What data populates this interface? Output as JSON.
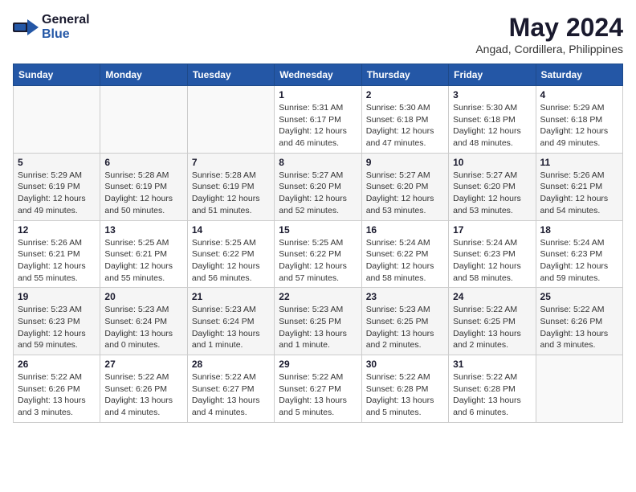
{
  "logo": {
    "general": "General",
    "blue": "Blue"
  },
  "title": "May 2024",
  "subtitle": "Angad, Cordillera, Philippines",
  "days_of_week": [
    "Sunday",
    "Monday",
    "Tuesday",
    "Wednesday",
    "Thursday",
    "Friday",
    "Saturday"
  ],
  "weeks": [
    [
      {
        "day": "",
        "info": ""
      },
      {
        "day": "",
        "info": ""
      },
      {
        "day": "",
        "info": ""
      },
      {
        "day": "1",
        "info": "Sunrise: 5:31 AM\nSunset: 6:17 PM\nDaylight: 12 hours\nand 46 minutes."
      },
      {
        "day": "2",
        "info": "Sunrise: 5:30 AM\nSunset: 6:18 PM\nDaylight: 12 hours\nand 47 minutes."
      },
      {
        "day": "3",
        "info": "Sunrise: 5:30 AM\nSunset: 6:18 PM\nDaylight: 12 hours\nand 48 minutes."
      },
      {
        "day": "4",
        "info": "Sunrise: 5:29 AM\nSunset: 6:18 PM\nDaylight: 12 hours\nand 49 minutes."
      }
    ],
    [
      {
        "day": "5",
        "info": "Sunrise: 5:29 AM\nSunset: 6:19 PM\nDaylight: 12 hours\nand 49 minutes."
      },
      {
        "day": "6",
        "info": "Sunrise: 5:28 AM\nSunset: 6:19 PM\nDaylight: 12 hours\nand 50 minutes."
      },
      {
        "day": "7",
        "info": "Sunrise: 5:28 AM\nSunset: 6:19 PM\nDaylight: 12 hours\nand 51 minutes."
      },
      {
        "day": "8",
        "info": "Sunrise: 5:27 AM\nSunset: 6:20 PM\nDaylight: 12 hours\nand 52 minutes."
      },
      {
        "day": "9",
        "info": "Sunrise: 5:27 AM\nSunset: 6:20 PM\nDaylight: 12 hours\nand 53 minutes."
      },
      {
        "day": "10",
        "info": "Sunrise: 5:27 AM\nSunset: 6:20 PM\nDaylight: 12 hours\nand 53 minutes."
      },
      {
        "day": "11",
        "info": "Sunrise: 5:26 AM\nSunset: 6:21 PM\nDaylight: 12 hours\nand 54 minutes."
      }
    ],
    [
      {
        "day": "12",
        "info": "Sunrise: 5:26 AM\nSunset: 6:21 PM\nDaylight: 12 hours\nand 55 minutes."
      },
      {
        "day": "13",
        "info": "Sunrise: 5:25 AM\nSunset: 6:21 PM\nDaylight: 12 hours\nand 55 minutes."
      },
      {
        "day": "14",
        "info": "Sunrise: 5:25 AM\nSunset: 6:22 PM\nDaylight: 12 hours\nand 56 minutes."
      },
      {
        "day": "15",
        "info": "Sunrise: 5:25 AM\nSunset: 6:22 PM\nDaylight: 12 hours\nand 57 minutes."
      },
      {
        "day": "16",
        "info": "Sunrise: 5:24 AM\nSunset: 6:22 PM\nDaylight: 12 hours\nand 58 minutes."
      },
      {
        "day": "17",
        "info": "Sunrise: 5:24 AM\nSunset: 6:23 PM\nDaylight: 12 hours\nand 58 minutes."
      },
      {
        "day": "18",
        "info": "Sunrise: 5:24 AM\nSunset: 6:23 PM\nDaylight: 12 hours\nand 59 minutes."
      }
    ],
    [
      {
        "day": "19",
        "info": "Sunrise: 5:23 AM\nSunset: 6:23 PM\nDaylight: 12 hours\nand 59 minutes."
      },
      {
        "day": "20",
        "info": "Sunrise: 5:23 AM\nSunset: 6:24 PM\nDaylight: 13 hours\nand 0 minutes."
      },
      {
        "day": "21",
        "info": "Sunrise: 5:23 AM\nSunset: 6:24 PM\nDaylight: 13 hours\nand 1 minute."
      },
      {
        "day": "22",
        "info": "Sunrise: 5:23 AM\nSunset: 6:25 PM\nDaylight: 13 hours\nand 1 minute."
      },
      {
        "day": "23",
        "info": "Sunrise: 5:23 AM\nSunset: 6:25 PM\nDaylight: 13 hours\nand 2 minutes."
      },
      {
        "day": "24",
        "info": "Sunrise: 5:22 AM\nSunset: 6:25 PM\nDaylight: 13 hours\nand 2 minutes."
      },
      {
        "day": "25",
        "info": "Sunrise: 5:22 AM\nSunset: 6:26 PM\nDaylight: 13 hours\nand 3 minutes."
      }
    ],
    [
      {
        "day": "26",
        "info": "Sunrise: 5:22 AM\nSunset: 6:26 PM\nDaylight: 13 hours\nand 3 minutes."
      },
      {
        "day": "27",
        "info": "Sunrise: 5:22 AM\nSunset: 6:26 PM\nDaylight: 13 hours\nand 4 minutes."
      },
      {
        "day": "28",
        "info": "Sunrise: 5:22 AM\nSunset: 6:27 PM\nDaylight: 13 hours\nand 4 minutes."
      },
      {
        "day": "29",
        "info": "Sunrise: 5:22 AM\nSunset: 6:27 PM\nDaylight: 13 hours\nand 5 minutes."
      },
      {
        "day": "30",
        "info": "Sunrise: 5:22 AM\nSunset: 6:28 PM\nDaylight: 13 hours\nand 5 minutes."
      },
      {
        "day": "31",
        "info": "Sunrise: 5:22 AM\nSunset: 6:28 PM\nDaylight: 13 hours\nand 6 minutes."
      },
      {
        "day": "",
        "info": ""
      }
    ]
  ]
}
